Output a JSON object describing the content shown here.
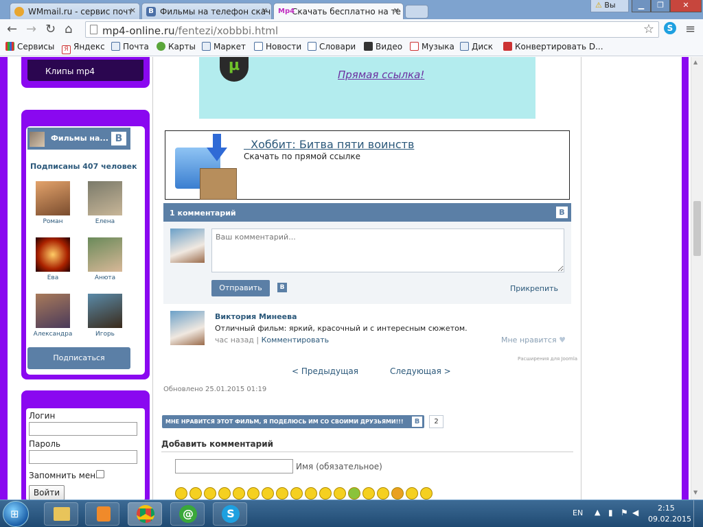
{
  "browser": {
    "tabs": [
      {
        "label": "WMmail.ru - сервис почт",
        "fav": "#e8a630"
      },
      {
        "label": "Фильмы на телефон скач",
        "fav": "#4b6fa6"
      },
      {
        "label": "Скачать бесплатно на те",
        "fav": "#c02dc0"
      }
    ],
    "user_badge": "Вы",
    "url_host": "mp4-online.ru",
    "url_path": "/fentezi/xobbbi.html",
    "bookmarks": [
      "Сервисы",
      "Яндекс",
      "Почта",
      "Карты",
      "Маркет",
      "Новости",
      "Словари",
      "Видео",
      "Музыка",
      "Диск",
      "Конвертировать D..."
    ]
  },
  "sidebar": {
    "clips_label": "Клипы mp4",
    "vk_widget_title": "Фильмы на...",
    "subscribers": "Подписаны 407 человек",
    "friends": [
      "Роман",
      "Елена",
      "Ева",
      "Анюта",
      "Александра",
      "Игорь"
    ],
    "subscribe_button": "Подписаться",
    "login_label": "Логин",
    "password_label": "Пароль",
    "remember_label": "Запомнить меня",
    "login_button": "Войти"
  },
  "main": {
    "direct_link": "Прямая ссылка!",
    "download_title": "Хоббит: Битва пяти воинств",
    "download_subtitle": "Скачать по прямой ссылке",
    "comments_header": "1 комментарий",
    "comment_placeholder": "Ваш комментарий...",
    "send_button": "Отправить",
    "attach_link": "Прикрепить",
    "comment": {
      "author": "Виктория Минеева",
      "text": "Отличный фильм: яркий, красочный и с интересным сюжетом.",
      "time": "час назад",
      "reply": "Комментировать",
      "like": "Мне нравится"
    },
    "extension_credit": "Расширения для Joomla",
    "prev_link": "< Предыдущая",
    "next_link": "Следующая >",
    "updated": "Обновлено 25.01.2015 01:19",
    "share_label": "МНЕ НРАВИТСЯ ЭТОТ ФИЛЬМ, Я ПОДЕЛЮСЬ ИМ СО СВОИМИ ДРУЗЬЯМИ!!!",
    "share_count": "2",
    "add_comment_heading": "Добавить комментарий",
    "name_placeholder_label": "Имя (обязательное)",
    "emoji_count": 18
  },
  "taskbar": {
    "lang": "EN",
    "time": "2:15",
    "date": "09.02.2015"
  },
  "colors": {
    "accent_purple": "#8a08f0",
    "vk_blue": "#5b7fa6",
    "link_purple": "#6b2fa0",
    "cyan_panel": "#b3ecee"
  }
}
